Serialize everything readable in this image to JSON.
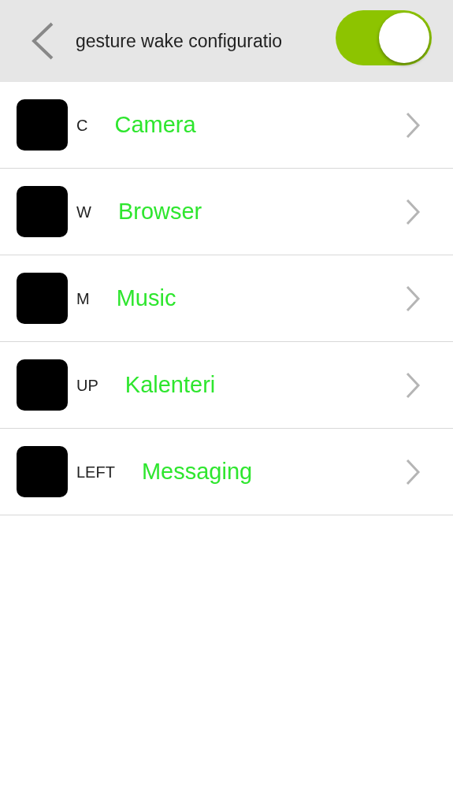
{
  "header": {
    "title": "gesture wake configuratio",
    "toggle": {
      "on": true
    }
  },
  "gestures": [
    {
      "gesture": "C",
      "app": "Camera"
    },
    {
      "gesture": "W",
      "app": "Browser"
    },
    {
      "gesture": "M",
      "app": "Music"
    },
    {
      "gesture": "UP",
      "app": "Kalenteri"
    },
    {
      "gesture": "LEFT",
      "app": "Messaging"
    }
  ]
}
